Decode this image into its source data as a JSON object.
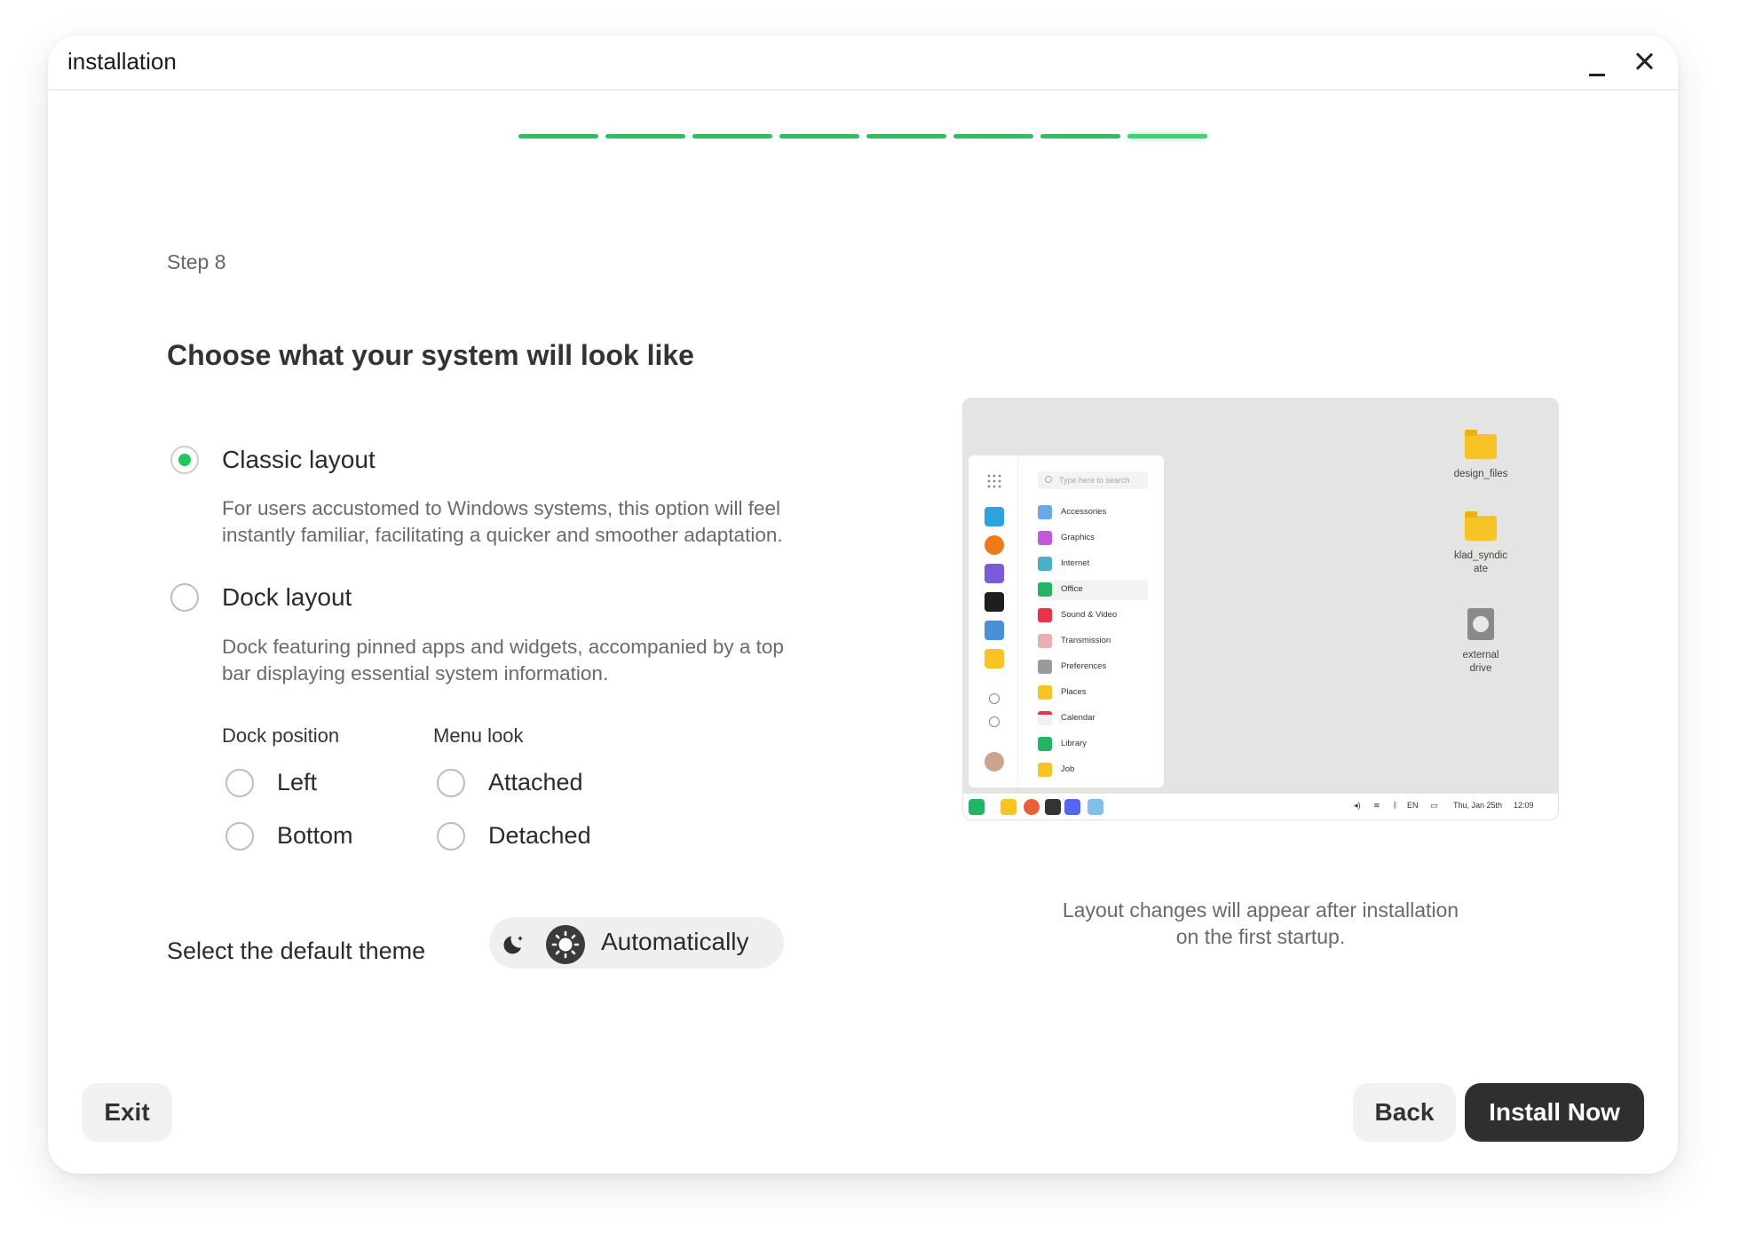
{
  "window": {
    "title": "installation"
  },
  "progress": {
    "total_steps": 8,
    "current_step": 8
  },
  "step_label": "Step 8",
  "heading": "Choose what your system will look like",
  "options": {
    "classic": {
      "label": "Classic layout",
      "description_line1": "For users accustomed to Windows systems, this option will feel",
      "description_line2": "instantly familiar, facilitating a quicker and smoother adaptation.",
      "selected": true
    },
    "dock": {
      "label": "Dock layout",
      "description_line1": "Dock featuring pinned apps and widgets, accompanied by a top",
      "description_line2": "bar displaying essential system information.",
      "selected": false
    }
  },
  "dock_position": {
    "heading": "Dock position",
    "options": [
      "Left",
      "Bottom"
    ]
  },
  "menu_look": {
    "heading": "Menu look",
    "options": [
      "Attached",
      "Detached"
    ]
  },
  "theme": {
    "label": "Select the default theme",
    "value": "Automatically"
  },
  "preview": {
    "search_placeholder": "Type here to search",
    "menu_items": [
      "Accessories",
      "Graphics",
      "Internet",
      "Office",
      "Sound & Video",
      "Transmission",
      "Preferences",
      "Places",
      "Calendar",
      "Library",
      "Job"
    ],
    "selected_menu_item": "Office",
    "desktop_icons": [
      "design_files",
      "klad_syndic",
      "ate",
      "external",
      "drive"
    ],
    "taskbar": {
      "lang": "EN",
      "date": "Thu, Jan 25th",
      "time": "12:09"
    },
    "note_line1": "Layout changes will appear after installation",
    "note_line2": "on the first startup."
  },
  "buttons": {
    "exit": "Exit",
    "back": "Back",
    "install": "Install Now"
  },
  "colors": {
    "accent": "#22c55e",
    "primary_button": "#2f2f2f",
    "secondary_button": "#f1f1f1"
  }
}
